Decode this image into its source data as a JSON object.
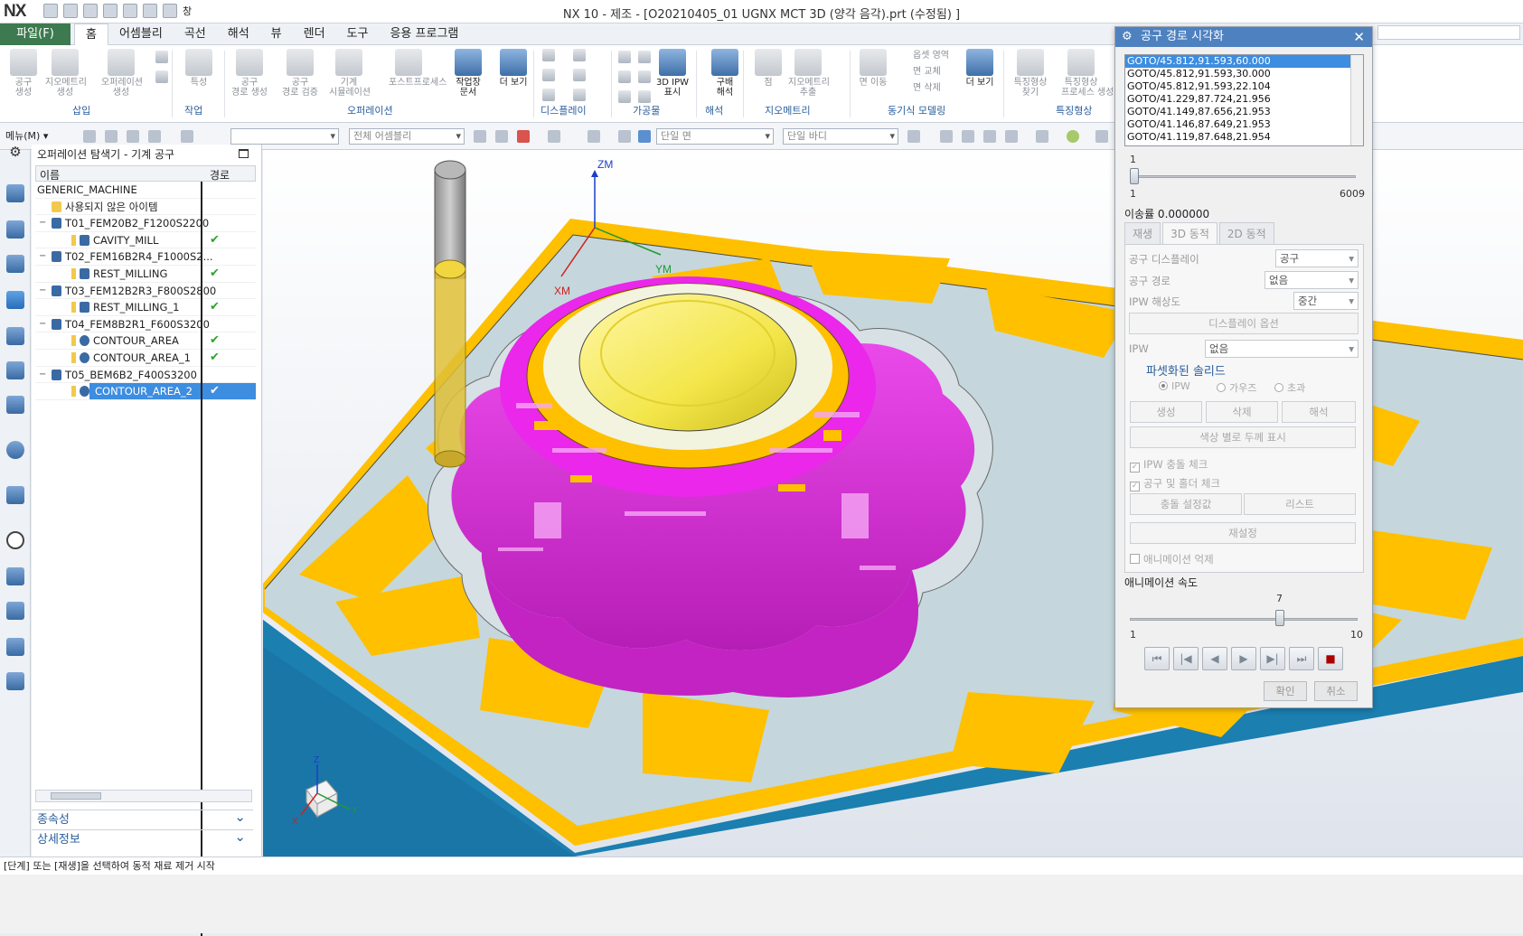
{
  "app": {
    "logo": "NX",
    "window_title": "NX 10 - 제조 - [O20210405_01 UGNX MCT 3D (양각 음각).prt (수정됨) ]",
    "window_menu": "창"
  },
  "menu": {
    "file": "파일(F)",
    "tabs": [
      "홈",
      "어셈블리",
      "곡선",
      "해석",
      "뷰",
      "렌더",
      "도구",
      "응용 프로그램"
    ]
  },
  "ribbon": {
    "buttons": [
      {
        "label": "공구\n생성",
        "enabled": false
      },
      {
        "label": "지오메트리\n생성",
        "enabled": false
      },
      {
        "label": "오퍼레이션\n생성",
        "enabled": false
      },
      {
        "label": "특성",
        "enabled": false
      },
      {
        "label": "공구\n경로 생성",
        "enabled": false
      },
      {
        "label": "공구\n경로 검증",
        "enabled": false
      },
      {
        "label": "기계\n시뮬레이션",
        "enabled": false
      },
      {
        "label": "포스트프로세스",
        "enabled": false
      },
      {
        "label": "작업장\n문서",
        "enabled": true
      },
      {
        "label": "더 보기",
        "enabled": true
      },
      {
        "label": "3D IPW\n표시",
        "enabled": true
      },
      {
        "label": "구배\n해석",
        "enabled": true
      },
      {
        "label": "점",
        "enabled": false
      },
      {
        "label": "지오메트리\n추출",
        "enabled": false
      },
      {
        "label": "면 이동",
        "enabled": false
      },
      {
        "label": "더 보기",
        "enabled": true
      },
      {
        "label": "특징형상\n찾기",
        "enabled": false
      },
      {
        "label": "특징형상\n프로세스 생성",
        "enabled": false
      }
    ],
    "small_items": [
      "옵셋 영역",
      "면 교체",
      "면 삭제"
    ],
    "groups": [
      "삽입",
      "작업",
      "오퍼레이션",
      "디스플레이",
      "가공물",
      "해석",
      "지오메트리",
      "동기식 모델링",
      "특징형상"
    ]
  },
  "toolbar2": {
    "menu": "메뉴(M)",
    "filter_combo": "전체 어셈블리",
    "face_combo": "단일 면",
    "body_combo": "단일 바디"
  },
  "navigator": {
    "title": "오퍼레이션 탐색기 - 기계 공구",
    "col_name": "이름",
    "col_path": "경로",
    "rows": [
      {
        "label": "GENERIC_MACHINE",
        "indent": 0,
        "type": "root",
        "check": false,
        "selected": false
      },
      {
        "label": "사용되지 않은 아이템",
        "indent": 1,
        "type": "folder",
        "check": false,
        "selected": false
      },
      {
        "label": "T01_FEM20B2_F1200S2200",
        "indent": 1,
        "type": "tool",
        "check": false,
        "selected": false
      },
      {
        "label": "CAVITY_MILL",
        "indent": 2,
        "type": "op",
        "check": true,
        "selected": false
      },
      {
        "label": "T02_FEM16B2R4_F1000S2...",
        "indent": 1,
        "type": "tool",
        "check": false,
        "selected": false
      },
      {
        "label": "REST_MILLING",
        "indent": 2,
        "type": "op",
        "check": true,
        "selected": false
      },
      {
        "label": "T03_FEM12B2R3_F800S2800",
        "indent": 1,
        "type": "tool",
        "check": false,
        "selected": false
      },
      {
        "label": "REST_MILLING_1",
        "indent": 2,
        "type": "op",
        "check": true,
        "selected": false
      },
      {
        "label": "T04_FEM8B2R1_F600S3200",
        "indent": 1,
        "type": "tool",
        "check": false,
        "selected": false
      },
      {
        "label": "CONTOUR_AREA",
        "indent": 2,
        "type": "op2",
        "check": true,
        "selected": false
      },
      {
        "label": "CONTOUR_AREA_1",
        "indent": 2,
        "type": "op2",
        "check": true,
        "selected": false
      },
      {
        "label": "T05_BEM6B2_F400S3200",
        "indent": 1,
        "type": "tool",
        "check": false,
        "selected": false
      },
      {
        "label": "CONTOUR_AREA_2",
        "indent": 2,
        "type": "op2",
        "check": true,
        "selected": true
      }
    ],
    "accordion": [
      "종속성",
      "상세정보"
    ]
  },
  "viewport": {
    "axis_zm": "ZM",
    "axis_xm": "XM",
    "axis_ym": "YM",
    "triad_z": "Z",
    "triad_x": "X",
    "triad_y": "Y",
    "colors": {
      "stock_yellow": "#ffc000",
      "finish_magenta": "#ea27ea",
      "base_blue": "#1b7fb0",
      "floor_grey": "#c5d7dd",
      "tool_yellow": "#f2d640"
    }
  },
  "dialog": {
    "title": "공구 경로 시각화",
    "gotos": [
      "GOTO/45.812,91.593,60.000",
      "GOTO/45.812,91.593,30.000",
      "GOTO/45.812,91.593,22.104",
      "GOTO/41.229,87.724,21.956",
      "GOTO/41.149,87.656,21.953",
      "GOTO/41.146,87.649,21.953",
      "GOTO/41.119,87.648,21.954"
    ],
    "step_value": "1",
    "step_min": "1",
    "step_max": "6009",
    "step_fraction": 0.0,
    "feed_label": "이송률 0.000000",
    "tabs": [
      "재생",
      "3D 동적",
      "2D 동적"
    ],
    "tool_display_label": "공구 디스플레이",
    "tool_display_value": "공구",
    "tool_path_label": "공구 경로",
    "tool_path_value": "없음",
    "ipw_res_label": "IPW 해상도",
    "ipw_res_value": "중간",
    "display_options": "디스플레이 옵션",
    "ipw_label": "IPW",
    "ipw_value": "없음",
    "faceted_group": "파셋화된 솔리드",
    "radios": [
      "IPW",
      "가우즈",
      "초과"
    ],
    "create_btn": "생성",
    "delete_btn": "삭제",
    "analyze_btn": "해석",
    "thickness_btn": "색상 별로 두께 표시",
    "chk_ipw_collision": "IPW 충돌 체크",
    "chk_tool_holder": "공구 및 홀더 체크",
    "collision_settings": "충돌 설정값",
    "list_btn": "리스트",
    "reset_btn": "재설정",
    "chk_suppress_anim": "애니메이션 억제",
    "anim_speed_label": "애니메이션 속도",
    "speed_value": "7",
    "speed_min": "1",
    "speed_max": "10",
    "speed_fraction": 0.667,
    "ok": "확인",
    "cancel": "취소"
  },
  "status": {
    "text": "[단계] 또는 [재생]을 선택하여 동적 재료 제거 시작"
  }
}
